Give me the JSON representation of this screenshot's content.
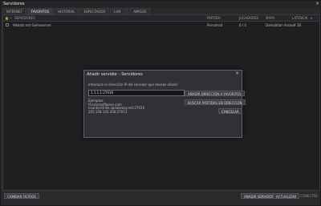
{
  "window": {
    "title": "Servidores"
  },
  "tabs": [
    {
      "label": "INTERNET",
      "active": false
    },
    {
      "label": "FAVORITOS",
      "active": true
    },
    {
      "label": "HISTORIAL",
      "active": false
    },
    {
      "label": "ESPECTADOR",
      "active": false
    },
    {
      "label": "LAN",
      "active": false
    },
    {
      "label": "AMIGOS",
      "active": false
    }
  ],
  "list": {
    "headers": {
      "servers": "SERVIDORES",
      "game": "PARTIDA",
      "players": "JUGADORES",
      "map": "MAPA",
      "latency": "LATENCIA"
    },
    "rows": [
      {
        "server": "Hitbotz.net Gameserver",
        "game": "Persotrad",
        "players": "0 / 4",
        "map": "Demolition Assault 1B"
      }
    ]
  },
  "bottom": {
    "change_filters": "CAMBIAR FILTROS",
    "add_server": "AÑADIR SERVIDOR",
    "refresh": "ACTUALIZAR",
    "connect": "CONECTAR"
  },
  "dialog": {
    "title": "Añadir servidor - Servidores",
    "instructions": "Introduce la dirección IP del servidor que deseas añadir.",
    "ip_value": "1.1.1.1:27016",
    "add_favorites": "AÑADIR DIRECCIÓN A FAVORITOS",
    "find_games": "BUSCAR PARTIDAS EN DIRECCIÓN",
    "cancel": "CANCELAR",
    "examples_title": "Ejemplos:",
    "examples": [
      "tf.valvesoftware.com",
      "counterstrike.speakeasy.net:27016",
      "205.158.143.200:27013"
    ]
  }
}
